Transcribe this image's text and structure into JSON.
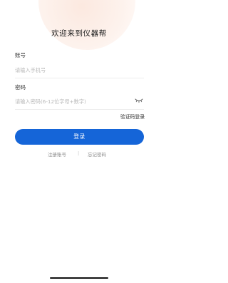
{
  "title": "欢迎来到仪器帮",
  "account": {
    "label": "账号",
    "placeholder": "请输入手机号",
    "value": ""
  },
  "password": {
    "label": "密码",
    "placeholder": "请输入密码(6-12位字母+数字)",
    "value": "",
    "toggle_icon": "eye-closed-icon"
  },
  "sms_login_label": "验证码登录",
  "login_button_label": "登录",
  "links": {
    "register_label": "注册账号",
    "separator": "|",
    "forgot_label": "忘记密码"
  },
  "colors": {
    "primary": "#1565d8",
    "decor": "#fbe6dc"
  }
}
